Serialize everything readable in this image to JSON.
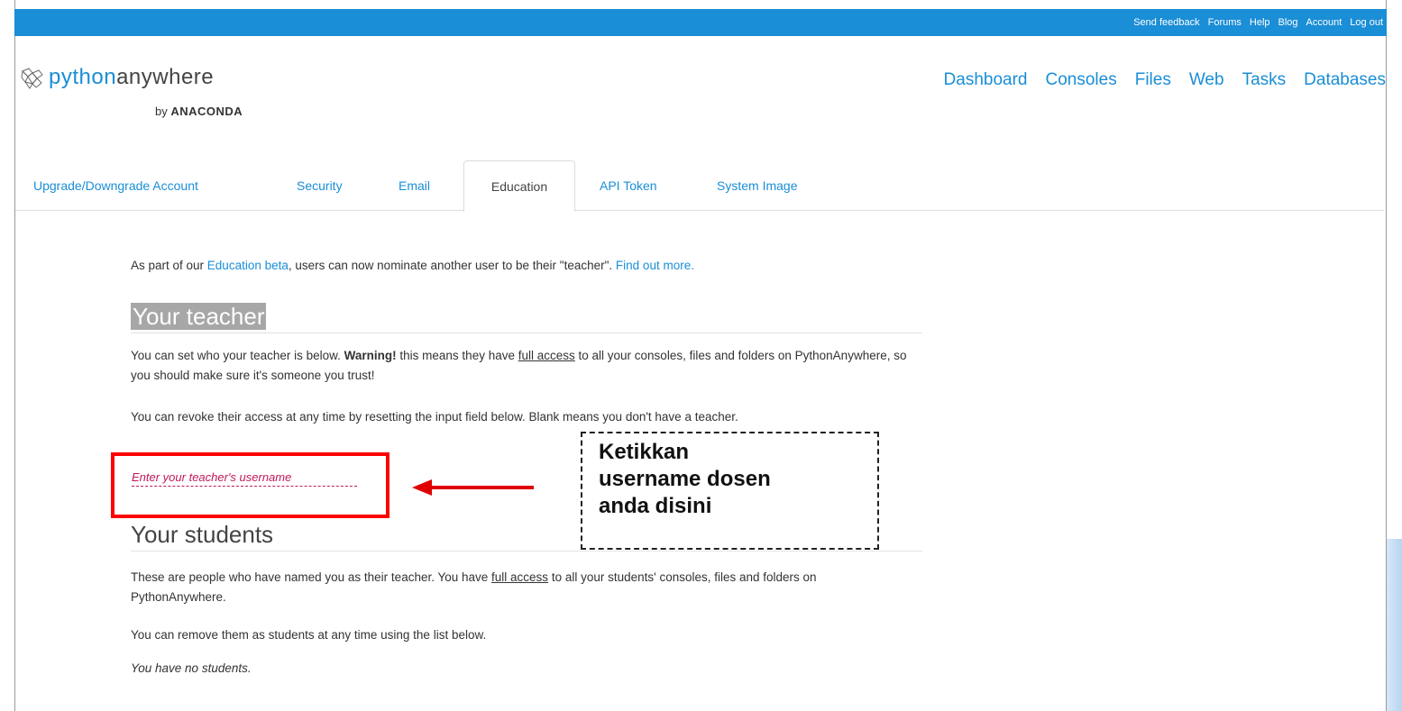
{
  "topbar": {
    "links": [
      "Send feedback",
      "Forums",
      "Help",
      "Blog",
      "Account",
      "Log out"
    ],
    "color": "#1a8ed6"
  },
  "logo": {
    "part1": "python",
    "part2": "anywhere",
    "by": "by",
    "brand": "ANACONDA",
    "icon": "pythonanywhere-logo-icon"
  },
  "nav": {
    "dashboard": "Dashboard",
    "consoles": "Consoles",
    "files": "Files",
    "web": "Web",
    "tasks": "Tasks",
    "databases": "Databases"
  },
  "tabs": {
    "upgrade": "Upgrade/Downgrade Account",
    "security": "Security",
    "email": "Email",
    "education": "Education",
    "api_token": "API Token",
    "system_image": "System Image",
    "active": "Education"
  },
  "intro": {
    "pre": "As part of our ",
    "link1": "Education beta",
    "mid": ", users can now nominate another user to be their \"teacher\". ",
    "link2": "Find out more."
  },
  "teacher": {
    "heading": "Your teacher",
    "p1_pre": "You can set who your teacher is below. ",
    "p1_warning": "Warning!",
    "p1_mid": " this means they have ",
    "p1_link": "full access",
    "p1_post": " to all your consoles, files and folders on PythonAnywhere, so you should make sure it's someone you trust!",
    "p2": "You can revoke their access at any time by resetting the input field below. Blank means you don't have a teacher.",
    "input_placeholder": "Enter your teacher's username"
  },
  "students": {
    "heading": "Your students",
    "p1_pre": "These are people who have named you as their teacher. You have ",
    "p1_link": "full access",
    "p1_post": " to all your students' consoles, files and folders on PythonAnywhere.",
    "p2": "You can remove them as students at any time using the list below.",
    "none": "You have no students."
  },
  "annotation": {
    "callout": "Ketikkan\nusername dosen\nanda disini",
    "box_color": "#ff0000"
  }
}
